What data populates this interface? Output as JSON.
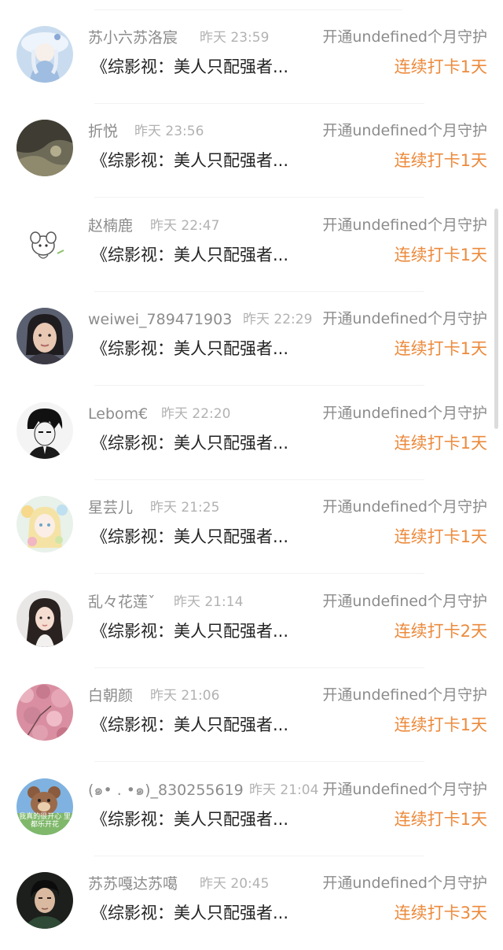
{
  "rows": [
    {
      "name": "苏小六苏洛宸",
      "time": "昨天 23:59",
      "guard": "开通undefined个月守护",
      "book": "《综影视：美人只配强者...",
      "streak": "连续打卡1天"
    },
    {
      "name": "折悦",
      "time": "昨天 23:56",
      "guard": "开通undefined个月守护",
      "book": "《综影视：美人只配强者...",
      "streak": "连续打卡1天"
    },
    {
      "name": "赵楠鹿",
      "time": "昨天 22:47",
      "guard": "开通undefined个月守护",
      "book": "《综影视：美人只配强者...",
      "streak": "连续打卡1天"
    },
    {
      "name": "weiwei_789471903",
      "time": "昨天 22:29",
      "guard": "开通undefined个月守护",
      "book": "《综影视：美人只配强者...",
      "streak": "连续打卡1天"
    },
    {
      "name": "Lebom€",
      "time": "昨天 22:20",
      "guard": "开通undefined个月守护",
      "book": "《综影视：美人只配强者...",
      "streak": "连续打卡1天"
    },
    {
      "name": "星芸儿",
      "time": "昨天 21:25",
      "guard": "开通undefined个月守护",
      "book": "《综影视：美人只配强者...",
      "streak": "连续打卡1天"
    },
    {
      "name": "乱々花莲ˇ",
      "time": "昨天 21:14",
      "guard": "开通undefined个月守护",
      "book": "《综影视：美人只配强者...",
      "streak": "连续打卡2天"
    },
    {
      "name": "白朝颜",
      "time": "昨天 21:06",
      "guard": "开通undefined个月守护",
      "book": "《综影视：美人只配强者...",
      "streak": "连续打卡1天"
    },
    {
      "name": "(๑• . •๑)_830255619",
      "time": "昨天 21:04",
      "guard": "开通undefined个月守护",
      "book": "《综影视：美人只配强者...",
      "streak": "连续打卡1天"
    },
    {
      "name": "苏苏嘎达苏噶",
      "time": "昨天 20:45",
      "guard": "开通undefined个月守护",
      "book": "《综影视：美人只配强者...",
      "streak": "连续打卡3天"
    }
  ],
  "avatar_images": [
    "anime girl with blue hat",
    "dark rock landscape",
    "white cartoon rat sketch",
    "young woman portrait",
    "monochrome anime boy",
    "pastel anime girl",
    "girl with long dark hair",
    "pink cherry blossoms",
    "cartoon bear meme",
    "man in dark jacket"
  ],
  "avatar_caption": "我真的很开心 里都乐开花",
  "colors": {
    "name": "#8c8c8c",
    "time": "#b2b2b2",
    "book": "#222222",
    "streak": "#ec8a3c",
    "divider": "#f2f2f2"
  }
}
